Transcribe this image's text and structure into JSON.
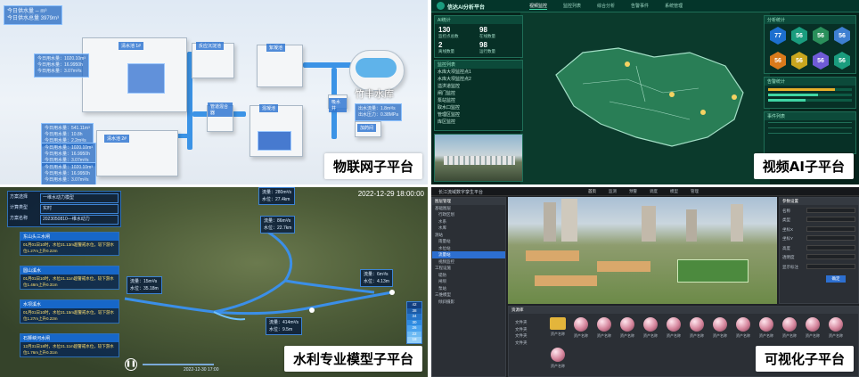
{
  "iot_panel": {
    "badge": "物联网子平台",
    "header_stats": [
      "今日供水量 -- m³",
      "今日供水总量 3979m³"
    ],
    "buildings": [
      "清水池 1#",
      "反应沉淀池",
      "絮凝池",
      "集水池",
      "清水池 2#",
      "管道混合器",
      "混凝池",
      "加药间",
      "吸水井"
    ],
    "reservoir_label": "竹丰水库",
    "left_labels": [
      "今日用水量：1020.10m³\n今日用水量：16.9950h\n今日用水量：3.07m³/s",
      "今日用水量：541.11m³\n今日用水量：10.8h\n今日用水量：2.2m³/s",
      "今日用水量：1020.10m³\n今日用水量：16.9950h\n今日用水量：3.07m³/s",
      "今日用水量：1020.10m³\n今日用水量：16.9950h\n今日用水量：3.07m³/s"
    ],
    "right_label": "出水流量：1.8m³/s\n出水压力：0.38MPa"
  },
  "ai_panel": {
    "badge": "视频AI子平台",
    "title": "信达AI分析平台",
    "tabs": [
      "视频监控",
      "监控列表",
      "综合分析",
      "告警事件",
      "系统管理"
    ],
    "left_title": "AI统计",
    "stats": [
      {
        "num": "130",
        "label": "监控点总数"
      },
      {
        "num": "98",
        "label": "在线数量"
      },
      {
        "num": "2",
        "label": "离线数量"
      },
      {
        "num": "98",
        "label": "运行数量"
      }
    ],
    "list_title": "监控列表",
    "list_items": [
      "水库大坝监控点1",
      "水库大坝监控点2",
      "溢洪道监控",
      "闸门监控",
      "泵站监控",
      "取水口监控",
      "管理区监控",
      "库区监控"
    ],
    "right_title": "分析统计",
    "hex_values": [
      "77",
      "56",
      "56",
      "56",
      "56",
      "56",
      "56",
      "56"
    ],
    "hex_colors": [
      "#1d6fcf",
      "#1a9c7e",
      "#2a8f5b",
      "#3e7fd1",
      "#d97a1b",
      "#c8a61e",
      "#6f5bd6",
      "#1a9c7e"
    ],
    "bar_title": "告警统计",
    "event_title": "事件列表"
  },
  "water_panel": {
    "badge": "水利专业模型子平台",
    "time": "2022-12-29 18:00:00",
    "filter_labels": [
      {
        "label": "方案选择",
        "value": "一维水动力模型"
      },
      {
        "label": "计算类型",
        "value": "实时"
      },
      {
        "label": "方案名称",
        "value": "2023050810—维水动力"
      }
    ],
    "cards": [
      {
        "title": "东山头三水闸",
        "body": "01月01日10时，水位21.13m超警戒水位，较下游水位1.27m上升0.22m"
      },
      {
        "title": "圆山溪水",
        "body": "01月01日10时，水位21.11m超警戒水位，较下游水位1.46m上升0.31m"
      },
      {
        "title": "水坝溪水",
        "body": "01月01日10时，水位21.15m超警戒水位，较下游水位1.27m上升0.22m"
      },
      {
        "title": "石狮峡河水闸",
        "body": "12月31日18时，水位21.11m超警戒水位，较下游水位1.76m上升0.31m"
      }
    ],
    "popups": [
      "流量：280m³/s\n水位：27.4km",
      "流量：86m³/s\n水位：22.7km",
      "流量：15m³/s\n水位：35.18m",
      "流量：6m³/s\n水位：4.13m",
      "流量：414m³/s\n水位：9.5m"
    ],
    "legend": [
      "42",
      "38",
      "34",
      "30",
      "26",
      "22",
      "18"
    ],
    "play_time": "2022-12-30 17:00"
  },
  "viz_panel": {
    "badge": "可视化子平台",
    "title": "长江流域数字孪生平台",
    "tabs": [
      "首页",
      "监测",
      "预警",
      "调度",
      "模型",
      "管理"
    ],
    "tree_title": "图层管理",
    "tree_items": [
      "基础图层",
      "行政区划",
      "水系",
      "水库",
      "测站",
      "雨量站",
      "水位站",
      "流量站",
      "视频监控",
      "工程设施",
      "堤防",
      "闸坝",
      "泵站",
      "三维模型",
      "倾斜摄影"
    ],
    "right_title": "参数设置",
    "right_fields": [
      "名称",
      "类型",
      "坐标X",
      "坐标Y",
      "高度",
      "透明度",
      "显示标注"
    ],
    "right_button": "确定",
    "asset_title": "资源库",
    "asset_folder": "文件夹",
    "asset_label": "资产名称",
    "asset_count": 14
  }
}
